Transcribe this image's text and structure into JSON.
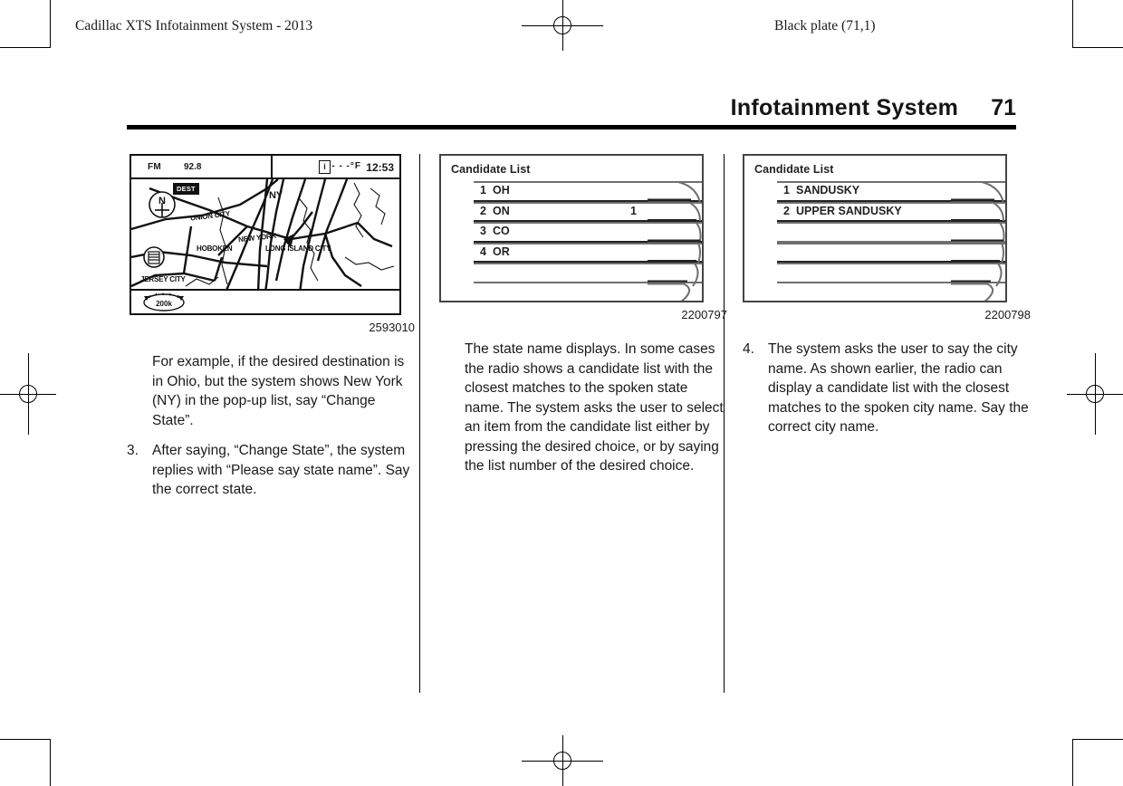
{
  "running_head": {
    "left": "Cadillac XTS Infotainment System - 2013",
    "right": "Black plate (71,1)"
  },
  "page_header": {
    "title": "Infotainment System",
    "page_number": "71"
  },
  "figures": [
    {
      "caption": "2593010",
      "type": "nav-map",
      "nav_screen": {
        "band": "FM",
        "frequency": "92.8",
        "info_icon": "i",
        "temperature": "- - -°F",
        "clock": "12:53",
        "compass_label": "N",
        "dest_button": "DEST",
        "scale_label": "200k",
        "map_labels": [
          "UNION CITY",
          "NEW YORK",
          "HOBOKEN",
          "LONG ISLAND CITY",
          "JERSEY CITY",
          "NY"
        ]
      }
    },
    {
      "caption": "2200797",
      "type": "candidate-list",
      "candidate_list": {
        "title": "Candidate List",
        "rows": [
          {
            "index": "1",
            "label": "OH",
            "right": ""
          },
          {
            "index": "2",
            "label": "ON",
            "right": "1"
          },
          {
            "index": "3",
            "label": "CO",
            "right": ""
          },
          {
            "index": "4",
            "label": "OR",
            "right": ""
          },
          {
            "index": "",
            "label": "",
            "right": ""
          }
        ]
      }
    },
    {
      "caption": "2200798",
      "type": "candidate-list",
      "candidate_list": {
        "title": "Candidate List",
        "rows": [
          {
            "index": "1",
            "label": "SANDUSKY",
            "right": ""
          },
          {
            "index": "2",
            "label": "UPPER SANDUSKY",
            "right": ""
          },
          {
            "index": "",
            "label": "",
            "right": ""
          },
          {
            "index": "",
            "label": "",
            "right": ""
          },
          {
            "index": "",
            "label": "",
            "right": ""
          }
        ]
      }
    }
  ],
  "column_1": {
    "paragraphs": [
      {
        "marker": "",
        "text": "For example, if the desired destination is in Ohio, but the system shows New York (NY) in the pop-up list, say “Change State”."
      },
      {
        "marker": "3.",
        "text": "After saying, “Change State”, the system replies with “Please say state name”. Say the correct state."
      }
    ]
  },
  "column_2": {
    "paragraphs": [
      {
        "marker": "",
        "text": "The state name displays. In some cases the radio shows a candidate list with the closest matches to the spoken state name. The system asks the user to select an item from the candidate list either by pressing the desired choice, or by saying the list number of the desired choice."
      }
    ]
  },
  "column_3": {
    "paragraphs": [
      {
        "marker": "4.",
        "text": "The system asks the user to say the city name. As shown earlier, the radio can display a candidate list with the closest matches to the spoken city name. Say the correct city name."
      }
    ]
  }
}
